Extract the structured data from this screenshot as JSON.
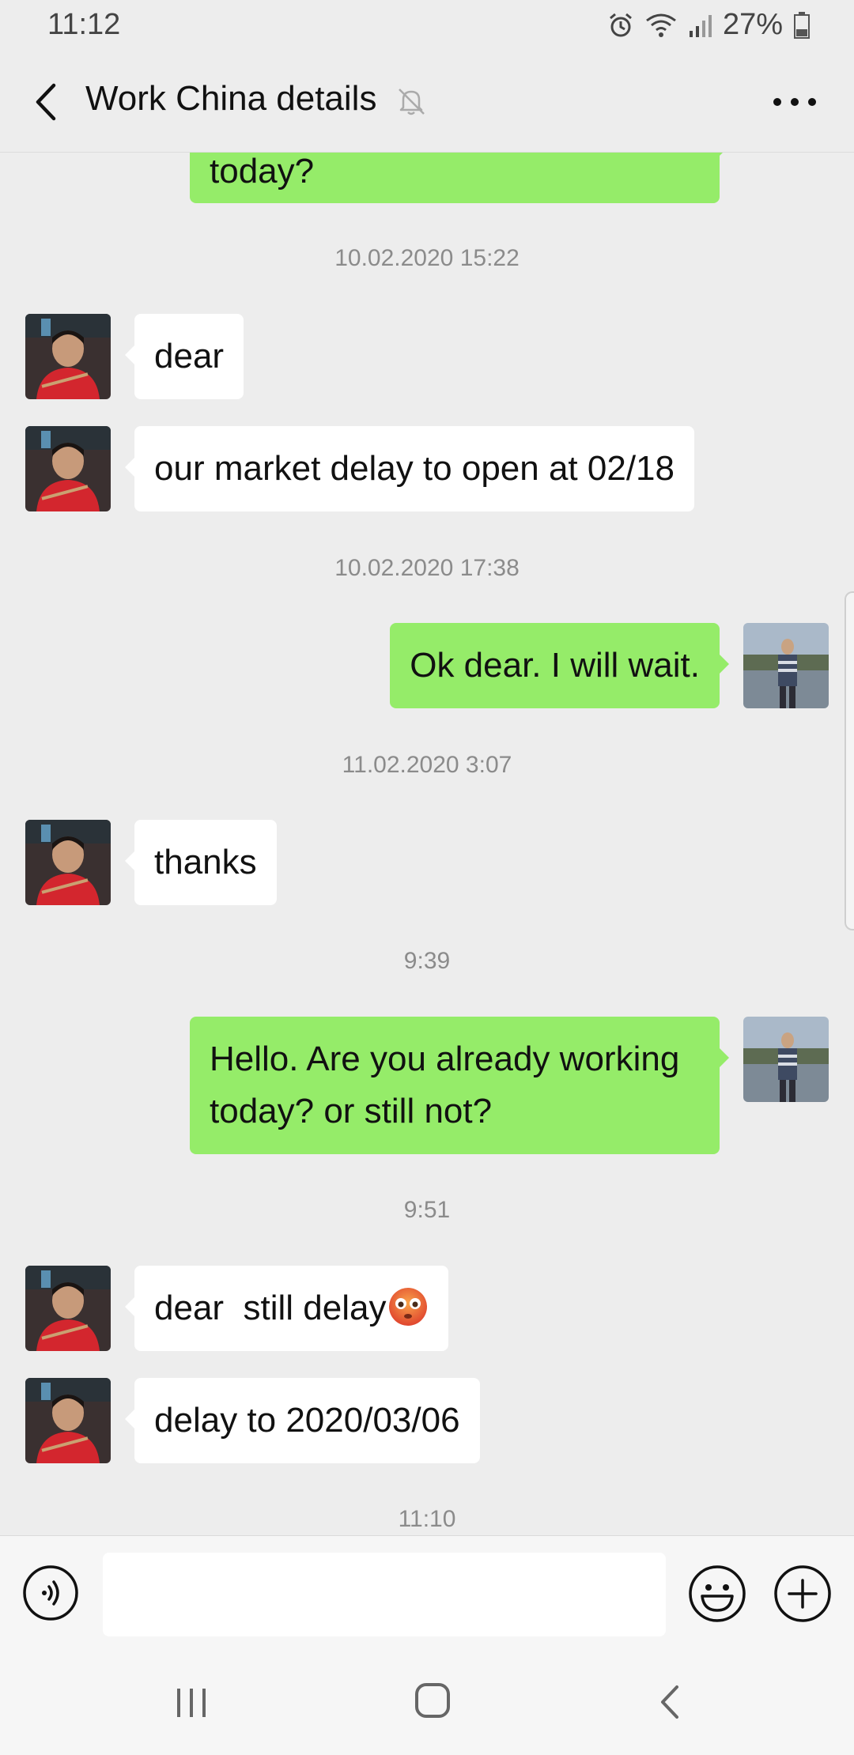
{
  "status_bar": {
    "time": "11:12",
    "battery": "27%"
  },
  "header": {
    "title": "Work China details",
    "back_icon": "chevron-left-icon",
    "mute_icon": "bell-off-icon",
    "more_icon": "more-dots-icon"
  },
  "messages": [
    {
      "kind": "out",
      "text": "today?"
    },
    {
      "kind": "time",
      "text": "10.02.2020 15:22"
    },
    {
      "kind": "in",
      "text": "dear"
    },
    {
      "kind": "in",
      "text": "our market delay to open at 02/18"
    },
    {
      "kind": "time",
      "text": "10.02.2020 17:38"
    },
    {
      "kind": "out",
      "text": "Ok dear. I will wait."
    },
    {
      "kind": "time",
      "text": "11.02.2020 3:07"
    },
    {
      "kind": "in",
      "text": "thanks"
    },
    {
      "kind": "time",
      "text": "9:39"
    },
    {
      "kind": "out",
      "text": "Hello. Are you already working today? or still not?"
    },
    {
      "kind": "time",
      "text": "9:51"
    },
    {
      "kind": "in",
      "text": "dear  still delay",
      "emoji": "flushed-face-emoji"
    },
    {
      "kind": "in",
      "text": "delay to 2020/03/06"
    },
    {
      "kind": "time",
      "text": "11:10"
    }
  ],
  "input_bar": {
    "placeholder": "",
    "voice_icon": "voice-input-icon",
    "emoji_icon": "smiley-icon",
    "plus_icon": "plus-circle-icon"
  },
  "colors": {
    "background": "#ededed",
    "outgoing_bubble": "#95ec69",
    "incoming_bubble": "#ffffff"
  }
}
